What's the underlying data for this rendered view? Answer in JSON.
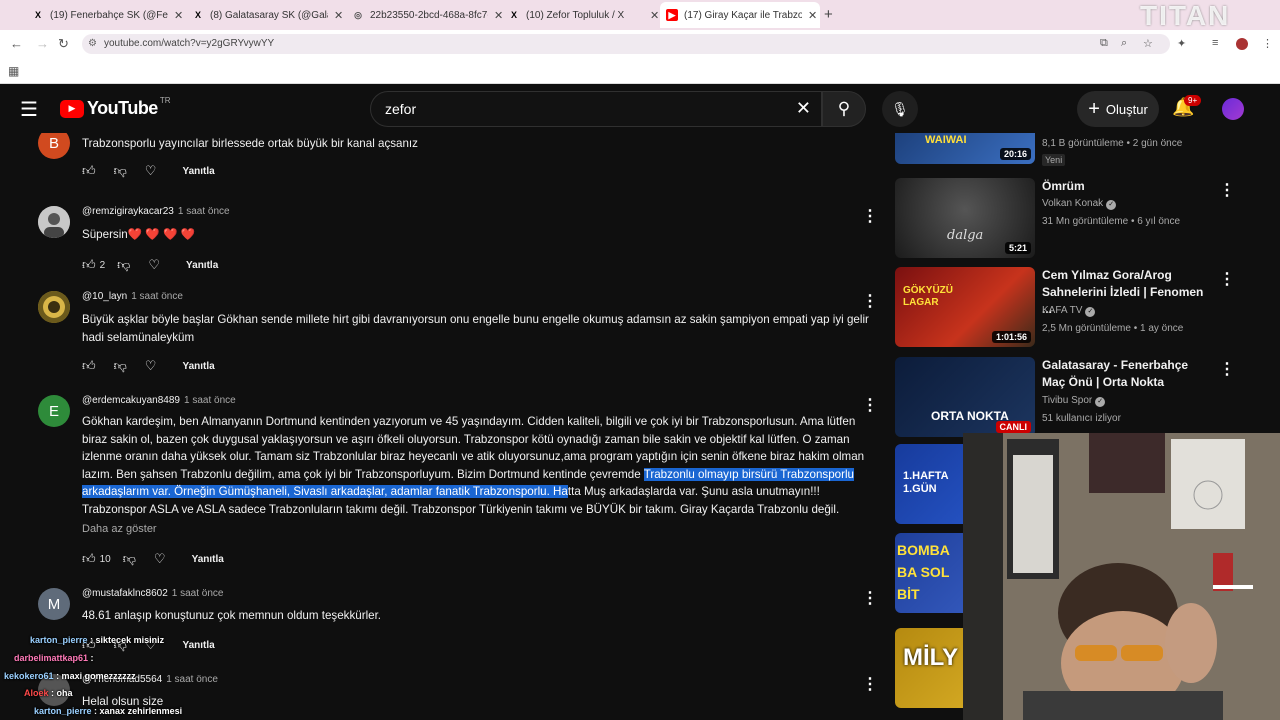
{
  "browser": {
    "tabs": [
      {
        "label": "(19) Fenerbahçe SK (@Fenerbah",
        "icon": "X"
      },
      {
        "label": "(8) Galatasaray SK (@Galatasara",
        "icon": "X"
      },
      {
        "label": "22b23550-2bcd-468a-8fc7-457f",
        "icon": "◎"
      },
      {
        "label": "(10) Zefor Topluluk / X",
        "icon": "X"
      },
      {
        "label": "(17) Giray Kaçar ile Trabzonspor",
        "icon": "▶"
      }
    ],
    "new_tab": "+",
    "url": "youtube.com/watch?v=y2gGRYvywYY",
    "watermark": "TITAN"
  },
  "youtube": {
    "logo_text": "YouTube",
    "region": "TR",
    "search_value": "zefor",
    "create_label": "Oluştur",
    "notif_count": "9+"
  },
  "comments": [
    {
      "avatar_letter": "B",
      "avatar_color": "#d14a1f",
      "author": "",
      "time": "",
      "text": "Trabzonsporlu yayıncılar birlessede ortak büyük bir kanal açsanız",
      "likes": "",
      "reply": "Yanıtla"
    },
    {
      "avatar_letter": "",
      "avatar_color": "#8a8a8a",
      "author": "@remzigiraykacar23",
      "time": "1 saat önce",
      "text": "Süpersin❤️ ❤️ ❤️ ❤️",
      "likes": "2",
      "reply": "Yanıtla"
    },
    {
      "avatar_letter": "",
      "avatar_color": "#c9a227",
      "author": "@10_layn",
      "time": "1 saat önce",
      "text": "Büyük aşklar böyle başlar Gökhan sende millete hirt gibi davranıyorsun onu engelle bunu engelle okumuş adamsın az sakin şampiyon empati yap iyi gelir hadi selamünaleyküm",
      "likes": "",
      "reply": "Yanıtla"
    },
    {
      "avatar_letter": "E",
      "avatar_color": "#2e8b3a",
      "author": "@erdemcakuyan8489",
      "time": "1 saat önce",
      "text_before": "Gökhan kardeşim, ben Almanyanın Dortmund kentinden yazıyorum ve 45 yaşındayım. Cidden kaliteli, bilgili ve çok iyi bir Trabzonsporlusun. Ama lütfen biraz sakin ol, bazen çok duygusal yaklaşıyorsun ve aşırı öfkeli oluyorsun. Trabzonspor kötü oynadığı zaman bile sakin ve objektif kal lütfen. O zaman izlenme oranın daha yüksek olur. Tamam siz Trabzonlular biraz heyecanlı ve atik oluyorsunuz,ama program yaptığın için senin öfkene biraz hakim olman lazım. Ben şahsen Trabzonlu değilim, ama çok iyi bir Trabzonsporluyum. Bizim Dortmund kentinde çevremde ",
      "text_selected": "Trabzonlu olmayıp birsürü Trabzonsporlu arkadaşlarım var. Örneğin Gümüşhaneli, Sivaslı arkadaşlar, adamlar fanatik Trabzonsporlu. Ha",
      "text_after": "tta Muş arkadaşlarda var. Şunu asla unutmayın!!! Trabzonspor ASLA ve ASLA sadece Trabzonluların takımı değil. Trabzonspor Türkiyenin takımı ve BÜYÜK bir takım. Giray Kaçarda Trabzonlu değil.",
      "show_less": "Daha az göster",
      "likes": "10",
      "reply": "Yanıtla"
    },
    {
      "avatar_letter": "M",
      "avatar_color": "#5f6b7a",
      "author": "@mustafaklnc8602",
      "time": "1 saat önce",
      "text": "48.61 anlaşıp konuştunuz çok memnun oldum teşekkürler.",
      "likes": "",
      "reply": "Yanıtla"
    },
    {
      "avatar_letter": "",
      "avatar_color": "#555",
      "author": "@Thenomad5564",
      "time": "1 saat önce",
      "text": "Helal olsun size",
      "likes": "",
      "reply": ""
    }
  ],
  "sidebar": [
    {
      "title": "",
      "channel": "",
      "meta": "8,1 B görüntüleme • 2 gün önce",
      "badge": "Yeni",
      "duration": "20:16",
      "thumb": "#1c3f7a",
      "thumb_text": "WAIWAI"
    },
    {
      "title": "Ömrüm",
      "channel": "Volkan Konak",
      "meta": "31 Mn görüntüleme • 6 yıl önce",
      "duration": "5:21",
      "thumb": "#2c2c2c",
      "thumb_text": "dalga"
    },
    {
      "title": "Cem Yılmaz Gora/Arog Sahnelerini İzledi | Fenomen ...",
      "channel": "KAFA TV",
      "meta": "2,5 Mn görüntüleme • 1 ay önce",
      "duration": "1:01:56",
      "thumb": "#7a1010",
      "thumb_text": "GÖKYÜZÜ LAGAR"
    },
    {
      "title": "Galatasaray - Fenerbahçe Maç Önü | Orta Nokta",
      "channel": "Tivibu Spor",
      "meta": "51 kullanıcı izliyor",
      "duration": "CANLI",
      "thumb": "#0c1c3a",
      "thumb_text": "ORTA NOKTA"
    },
    {
      "title": "",
      "channel": "",
      "meta": "",
      "duration": "",
      "thumb": "#173b9c",
      "thumb_text": "1.HAFTA 1.GÜN"
    },
    {
      "title": "",
      "channel": "",
      "meta": "",
      "duration": "",
      "thumb": "#1f3f9a",
      "thumb_text": "BOMBA BA SOL BİT"
    },
    {
      "title": "",
      "channel": "",
      "meta": "",
      "duration": "",
      "thumb": "#b58a10",
      "thumb_text": "MİLY"
    }
  ],
  "chat": [
    {
      "user": "karton_pierre",
      "msg": ": siktecek misiniz"
    },
    {
      "user": "darbelimattkap61",
      "msg": ":"
    },
    {
      "user": "kekokero61",
      "msg": ": maxi gomezzzzzz"
    },
    {
      "user": "Aloek",
      "msg": ": oha"
    },
    {
      "user": "karton_pierre",
      "msg": ": xanax zehirlenmesi"
    }
  ]
}
